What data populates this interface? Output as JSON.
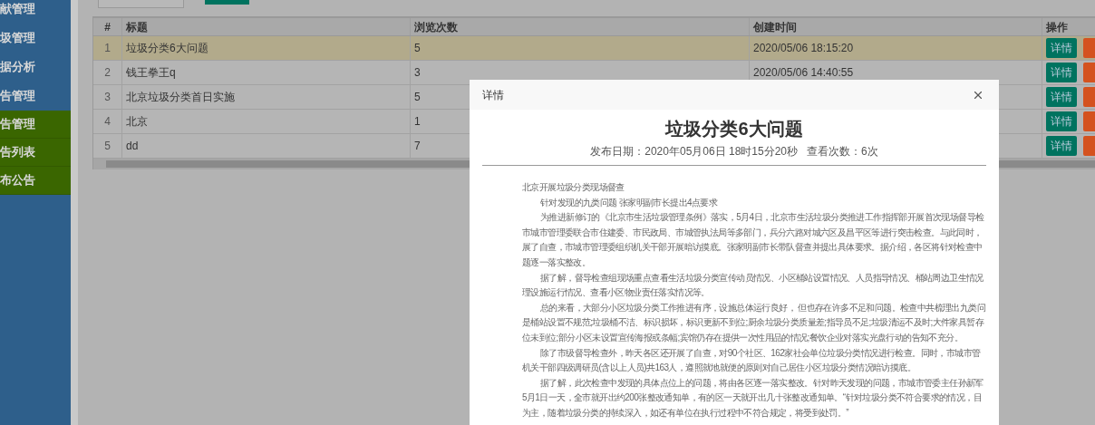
{
  "sidebar": {
    "items": [
      {
        "label": "献管理",
        "kind": "group"
      },
      {
        "label": "圾管理",
        "kind": "group"
      },
      {
        "label": "据分析",
        "kind": "group"
      },
      {
        "label": "告管理",
        "kind": "group"
      },
      {
        "label": "告管理",
        "kind": "sub"
      },
      {
        "label": "告列表",
        "kind": "sub"
      },
      {
        "label": "布公告",
        "kind": "sub"
      }
    ]
  },
  "table": {
    "columns": [
      "#",
      "标题",
      "浏览次数",
      "创建时间",
      "操作"
    ],
    "rows": [
      {
        "cells": [
          "1",
          "垃圾分类6大问题",
          "5",
          "2020/05/06 18:15:20"
        ],
        "action": "详情",
        "selected": true
      },
      {
        "cells": [
          "2",
          "钱王拳王q",
          "3",
          "2020/05/06 14:40:55"
        ],
        "action": "详情",
        "selected": false
      },
      {
        "cells": [
          "3",
          "北京垃圾分类首日实施",
          "5"
        ],
        "action": "详情",
        "selected": false
      },
      {
        "cells": [
          "4",
          "北京",
          "1"
        ],
        "action": "详情",
        "selected": false
      },
      {
        "cells": [
          "5",
          "dd",
          "7"
        ],
        "action": "详情",
        "selected": false
      }
    ]
  },
  "dialog": {
    "title": "详情",
    "heading": "垃圾分类6大问题",
    "publish_date": "发布日期：2020年05月06日 18时15分20秒",
    "views": "查看次数：6次",
    "paragraphs": [
      {
        "indented": false,
        "lines": [
          "北京开展垃圾分类现场督查"
        ]
      },
      {
        "indented": true,
        "lines": [
          "针对发现的九类问题 张家明副市长提出4点要求"
        ]
      },
      {
        "indented": true,
        "lines": [
          "为推进新修订的《北京市生活垃圾管理条例》落实，5月4日，北京市生活垃圾分类推进工作指挥部开展首次现场督导检",
          "市城市管理委联合市住建委、市民政局、市城管执法局等多部门，兵分六路对城六区及昌平区等进行突击检查。与此同时，",
          "展了自查，市城市管理委组织机关干部开展暗访摸底。张家明副市长带队督查并提出具体要求。据介绍，各区将针对检查中",
          "题逐一落实整改。"
        ]
      },
      {
        "indented": true,
        "lines": [
          "据了解，督导检查组现场重点查看生活垃圾分类宣传动员情况、小区桶站设置情况、人员指导情况、桶站周边卫生情况",
          "理设施运行情况、查看小区物业责任落实情况等。"
        ]
      },
      {
        "indented": true,
        "lines": [
          "总的来看，大部分小区垃圾分类工作推进有序，设施总体运行良好， 但也存在许多不足和问题。检查中共梳理出九类问",
          "是桶站设置不规范;垃圾桶不洁、标识损坏，标识更新不到位;厨余垃圾分类质量差;指导员不足;垃圾清运不及时;大件家具暂存",
          "位未到位;部分小区未设置宣传海报或条幅;宾馆仍存在提供一次性用品的情况;餐饮企业对落实光盘行动的告知不充分。"
        ]
      },
      {
        "indented": true,
        "lines": [
          "除了市级督导检查外，昨天各区还开展了自查，对90个社区、162家社会单位垃圾分类情况进行检查。同时，市城市管",
          "机关干部四级调研员(含以上人员)共163人，遵照就地就便的原则对自己居住小区垃圾分类情况暗访摸底。"
        ]
      },
      {
        "indented": true,
        "lines": [
          "据了解，此次检查中发现的具体点位上的问题，将由各区逐一落实整改。针对昨天发现的问题，市城市管委主任孙新军",
          "5月1日一天，全市就开出约200张整改通知单，有的区一天就开出几十张整改通知单。“针对垃圾分类不符合要求的情况，目",
          "为主，随着垃圾分类的持续深入，如还有单位在执行过程中不符合规定，将受到处罚。”"
        ]
      }
    ]
  }
}
